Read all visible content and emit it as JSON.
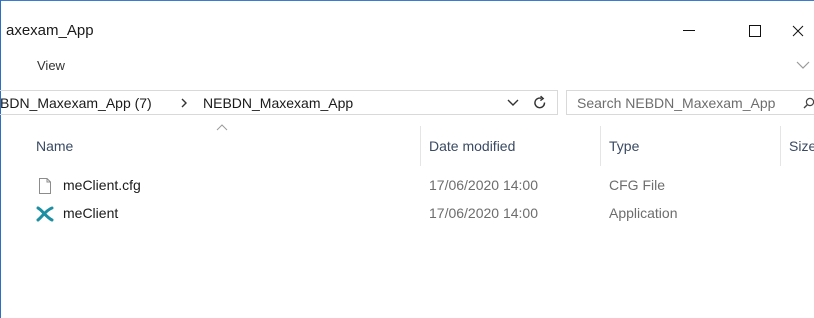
{
  "window": {
    "title": "axexam_App",
    "controls": {
      "minimize": "minimize",
      "maximize": "maximize",
      "close": "close"
    }
  },
  "ribbon": {
    "view_label": "View"
  },
  "address": {
    "crumb_1": "BDN_Maxexam_App (7)",
    "crumb_2": "NEBDN_Maxexam_App"
  },
  "search": {
    "placeholder": "Search NEBDN_Maxexam_App"
  },
  "columns": {
    "name": "Name",
    "date": "Date modified",
    "type": "Type",
    "size": "Size"
  },
  "files": [
    {
      "name": "meClient.cfg",
      "date": "17/06/2020 14:00",
      "type": "CFG File",
      "icon": "file-icon"
    },
    {
      "name": "meClient",
      "date": "17/06/2020 14:00",
      "type": "Application",
      "icon": "app-icon"
    }
  ],
  "colors": {
    "accent": "#3b7bd0",
    "header_text": "#3a4a63",
    "muted_text": "#6d6d6d",
    "app_icon": "#1d8fa3"
  }
}
